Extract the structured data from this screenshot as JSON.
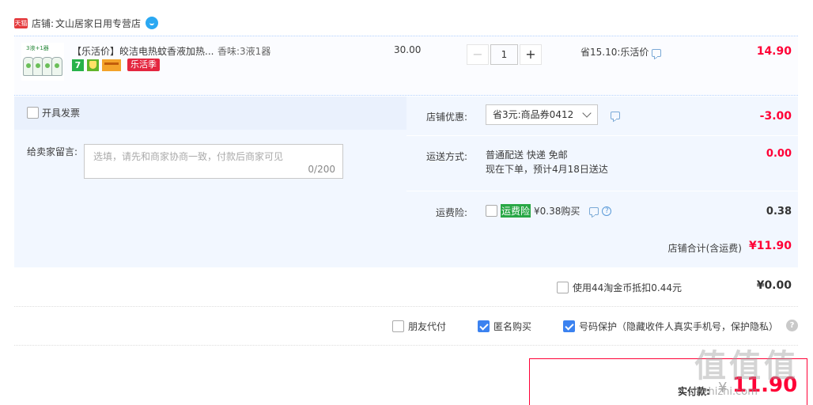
{
  "shop": {
    "tmall_badge": "天猫",
    "prefix": "店铺:",
    "name": "文山居家日用专营店"
  },
  "item": {
    "thumb_caption": "3液+1器",
    "title": "【乐活价】皎洁电热蚊香液加热...",
    "spec": "香味:3液1器",
    "badge_seven": "7",
    "badge_promo": "乐活季",
    "unit_price": "30.00",
    "qty_minus": "−",
    "quantity": "1",
    "qty_plus": "+",
    "saving": "省15.10:乐活价",
    "total": "14.90"
  },
  "invoice": {
    "label": "开具发票"
  },
  "message": {
    "label": "给卖家留言:",
    "placeholder": "选填，请先和商家协商一致，付款后商家可见",
    "counter": "0/200"
  },
  "discount": {
    "label": "店铺优惠:",
    "selected": "省3元:商品券0412",
    "value": "-3.00"
  },
  "shipping": {
    "label": "运送方式:",
    "line1": "普通配送 快递 免邮",
    "line2": "现在下单，预计4月18日送达",
    "value": "0.00"
  },
  "insurance": {
    "label": "运费险:",
    "tag": "运费险",
    "text": "¥0.38购买",
    "value": "0.38"
  },
  "subtotal": {
    "label": "店铺合计(含运费)",
    "value": "¥11.90"
  },
  "coins": {
    "label": "使用44淘金币抵扣0.44元",
    "value": "¥0.00"
  },
  "options": {
    "friend_pay": "朋友代付",
    "anonymous": "匿名购买",
    "privacy": "号码保护（隐藏收件人真实手机号，保护隐私）",
    "help": "?"
  },
  "payment": {
    "label": "实付款:",
    "currency": "¥",
    "value": "11.90"
  },
  "watermark": {
    "text": "值值值",
    "sub": "zhizhizhi.com"
  },
  "colors": {
    "price_red": "#ff0036",
    "panel_blue": "#f2f7ff",
    "check_blue": "#3b82f0",
    "promo_red": "#e4263f"
  }
}
